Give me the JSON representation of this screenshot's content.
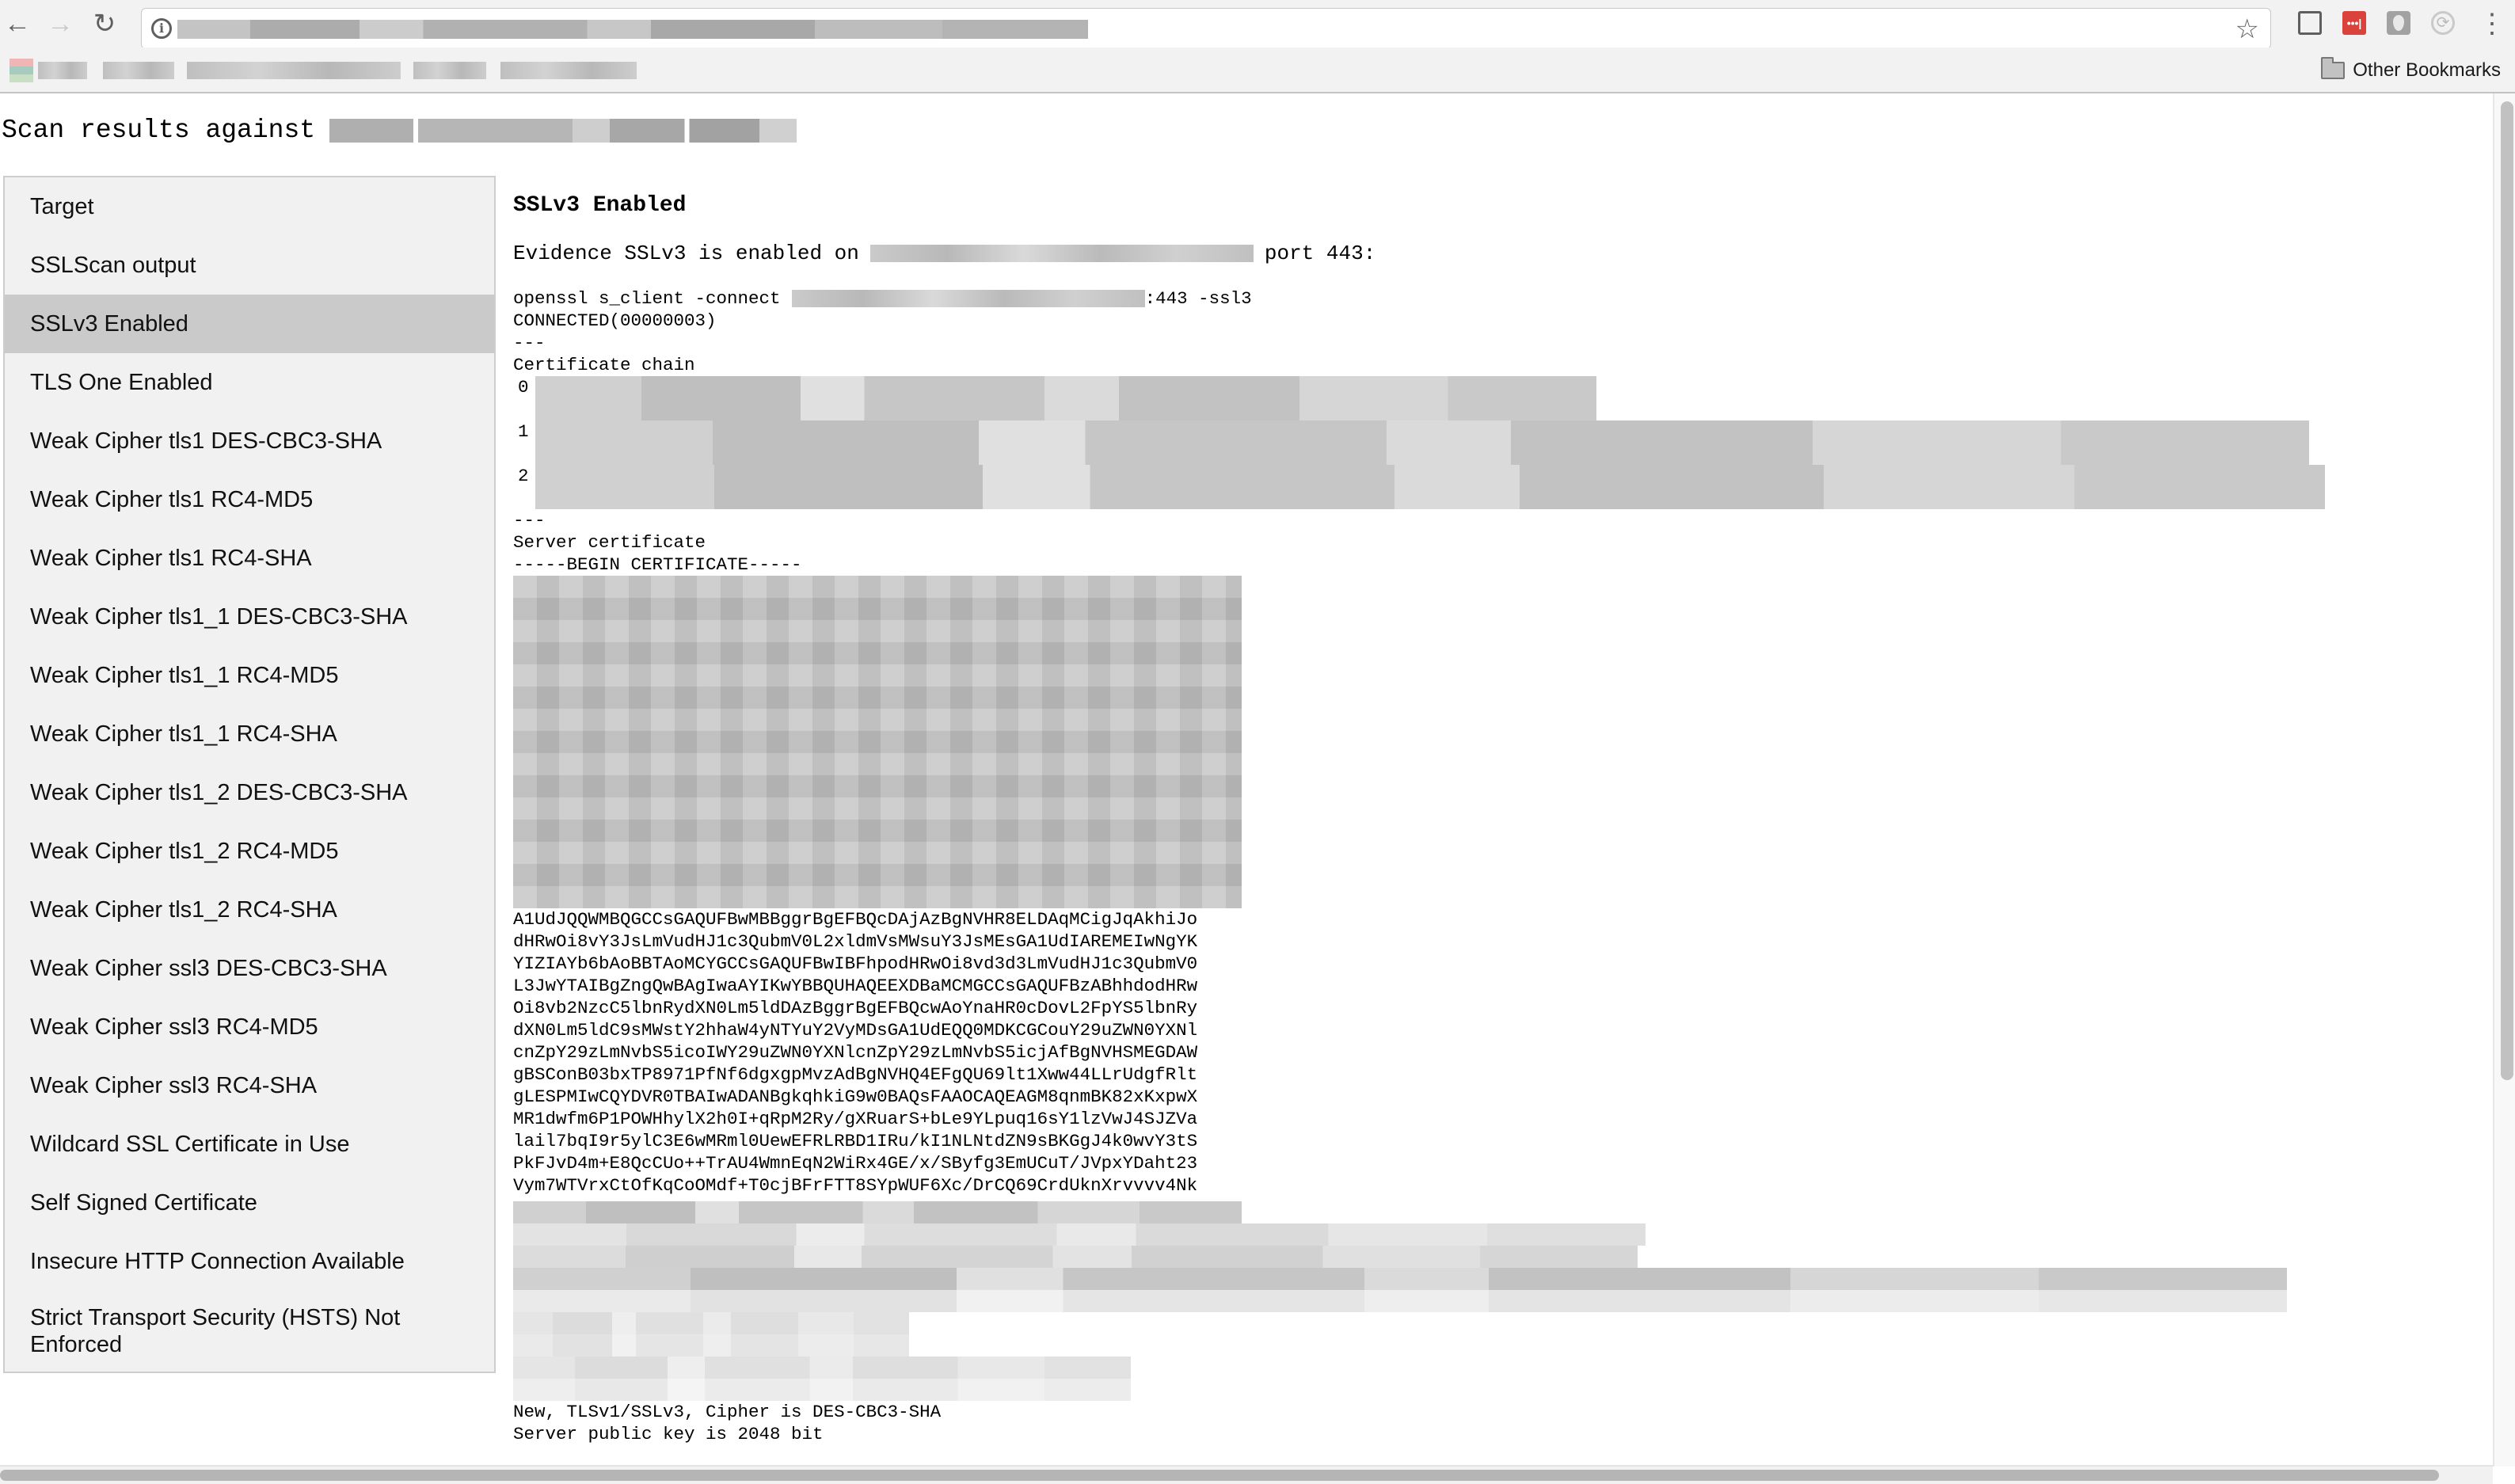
{
  "browser": {
    "nav": {
      "back_icon": "←",
      "forward_icon": "→",
      "reload_icon": "↻",
      "info_icon": "i",
      "star_icon": "☆",
      "cast_icon": "cast-icon",
      "lastpass_icon": "•••|",
      "menu_icon": "⋮"
    },
    "url": "[redacted]",
    "bookmarks": {
      "other_bookmarks_label": "Other Bookmarks"
    }
  },
  "page": {
    "heading_prefix": "Scan results against",
    "target_host": "[redacted]"
  },
  "sidebar": {
    "active_index": 2,
    "items": [
      {
        "label": "Target"
      },
      {
        "label": "SSLScan output"
      },
      {
        "label": "SSLv3 Enabled"
      },
      {
        "label": "TLS One Enabled"
      },
      {
        "label": "Weak Cipher tls1 DES-CBC3-SHA"
      },
      {
        "label": "Weak Cipher tls1 RC4-MD5"
      },
      {
        "label": "Weak Cipher tls1 RC4-SHA"
      },
      {
        "label": "Weak Cipher tls1_1 DES-CBC3-SHA"
      },
      {
        "label": "Weak Cipher tls1_1 RC4-MD5"
      },
      {
        "label": "Weak Cipher tls1_1 RC4-SHA"
      },
      {
        "label": "Weak Cipher tls1_2 DES-CBC3-SHA"
      },
      {
        "label": "Weak Cipher tls1_2 RC4-MD5"
      },
      {
        "label": "Weak Cipher tls1_2 RC4-SHA"
      },
      {
        "label": "Weak Cipher ssl3 DES-CBC3-SHA"
      },
      {
        "label": "Weak Cipher ssl3 RC4-MD5"
      },
      {
        "label": "Weak Cipher ssl3 RC4-SHA"
      },
      {
        "label": "Wildcard SSL Certificate in Use"
      },
      {
        "label": "Self Signed Certificate"
      },
      {
        "label": "Insecure HTTP Connection Available"
      },
      {
        "label": "Strict Transport Security (HSTS) Not Enforced"
      }
    ]
  },
  "finding": {
    "title": "SSLv3 Enabled",
    "evidence_prefix": "Evidence SSLv3 is enabled on",
    "evidence_suffix": "port 443:",
    "command_prefix": "openssl s_client -connect",
    "command_suffix": ":443 -ssl3",
    "connected": "CONNECTED(00000003)",
    "separator": "---",
    "chain_heading": "Certificate chain",
    "chain_indices": [
      "0",
      "1",
      "2"
    ],
    "server_cert_heading": "Server certificate",
    "begin_cert": "-----BEGIN CERTIFICATE-----",
    "cert_visible_lines": [
      "A1UdJQQWMBQGCCsGAQUFBwMBBggrBgEFBQcDAjAzBgNVHR8ELDAqMCigJqAkhiJo",
      "dHRwOi8vY3JsLmVudHJ1c3QubmV0L2xldmVsMWsuY3JsMEsGA1UdIAREMEIwNgYK",
      "YIZIAYb6bAoBBTAoMCYGCCsGAQUFBwIBFhpodHRwOi8vd3d3LmVudHJ1c3QubmV0",
      "L3JwYTAIBgZngQwBAgIwaAYIKwYBBQUHAQEEXDBaMCMGCCsGAQUFBzABhhdodHRw",
      "Oi8vb2NzcC5lbnRydXN0Lm5ldDAzBggrBgEFBQcwAoYnaHR0cDovL2FpYS5lbnRy",
      "dXN0Lm5ldC9sMWstY2hhaW4yNTYuY2VyMDsGA1UdEQQ0MDKCGCouY29uZWN0YXNl",
      "cnZpY29zLmNvbS5icoIWY29uZWN0YXNlcnZpY29zLmNvbS5icjAfBgNVHSMEGDAW",
      "gBSConB03bxTP8971PfNf6dgxgpMvzAdBgNVHQ4EFgQU69lt1Xww44LLrUdgfRlt",
      "gLESPMIwCQYDVR0TBAIwADANBgkqhkiG9w0BAQsFAAOCAQEAGM8qnmBK82xKxpwX",
      "MR1dwfm6P1POWHhylX2h0I+qRpM2Ry/gXRuarS+bLe9YLpuq16sY1lzVwJ4SJZVa",
      "lail7bqI9r5ylC3E6wMRml0UewEFRLRBD1IRu/kI1NLNtdZN9sBKGgJ4k0wvY3tS",
      "PkFJvD4m+E8QcCUo++TrAU4WmnEqN2WiRx4GE/x/SByfg3EmUCuT/JVpxYDaht23",
      "Vym7WTVrxCtOfKqCoOMdf+T0cjBFrFTT8SYpWUF6Xc/DrCQ69CrdUknXrvvvv4Nk"
    ],
    "cipher_line": "New, TLSv1/SSLv3, Cipher is DES-CBC3-SHA",
    "pubkey_line": "Server public key is 2048 bit"
  }
}
